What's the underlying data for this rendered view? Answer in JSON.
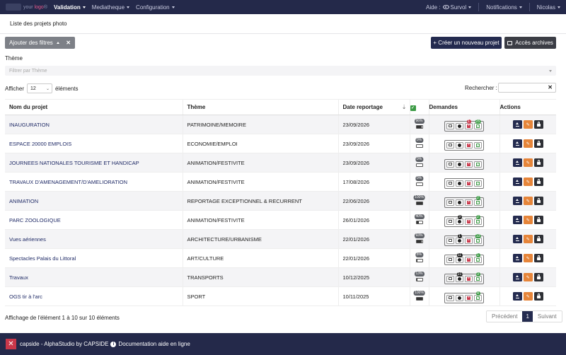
{
  "nav": {
    "logo_prefix": "your",
    "logo_accent": "logo",
    "logo_suffix": "®",
    "items": [
      {
        "label": "Validation",
        "active": true
      },
      {
        "label": "Mediatheque"
      },
      {
        "label": "Configuration"
      }
    ],
    "right": {
      "aide": "Aide :",
      "survol": "Survol",
      "notifications": "Notifications",
      "user": "Nicolas"
    }
  },
  "page": {
    "title": "Liste des projets photo"
  },
  "toolbar": {
    "filters_label": "Ajouter des filtres",
    "new_project": "+ Créer un nouveau projet",
    "archives": "Accès archives"
  },
  "theme_filter": {
    "label": "Thème",
    "placeholder": "Filtrer par Thème"
  },
  "length": {
    "prefix": "Afficher",
    "value": "12",
    "suffix": "éléments"
  },
  "search": {
    "label": "Rechercher :",
    "value": ""
  },
  "table": {
    "headers": {
      "name": "Nom du projet",
      "theme": "Thème",
      "date": "Date reportage",
      "requests": "Demandes",
      "actions": "Actions"
    },
    "rows": [
      {
        "name": "INAUGURATION",
        "theme": "PATRIMOINE/MEMOIRE",
        "date": "23/09/2026",
        "pct": "96%",
        "fill": 0.96,
        "clk": "",
        "x": "1",
        "ok": "25"
      },
      {
        "name": "ESPACE 20000 EMPLOIS",
        "theme": "ECONOMIE/EMPLOI",
        "date": "23/09/2026",
        "pct": "0%",
        "fill": 0,
        "clk": "",
        "x": "",
        "ok": ""
      },
      {
        "name": "JOURNEES NATIONALES TOURISME ET HANDICAP",
        "theme": "ANIMATION/FESTIVITE",
        "date": "23/09/2026",
        "pct": "0%",
        "fill": 0,
        "clk": "",
        "x": "",
        "ok": ""
      },
      {
        "name": "TRAVAUX D'AMENAGEMENT/D'AMELIORATION",
        "theme": "ANIMATION/FESTIVITE",
        "date": "17/08/2026",
        "pct": "0%",
        "fill": 0,
        "clk": "",
        "x": "",
        "ok": ""
      },
      {
        "name": "ANIMATION",
        "theme": "REPORTAGE EXCEPTIONNEL & RECURRENT",
        "date": "22/06/2026",
        "pct": "100%",
        "fill": 1,
        "clk": "",
        "x": "",
        "ok": "2"
      },
      {
        "name": "PARC ZOOLOGIQUE",
        "theme": "ANIMATION/FESTIVITE",
        "date": "26/01/2026",
        "pct": "40%",
        "fill": 0.4,
        "clk": "3",
        "x": "",
        "ok": "2"
      },
      {
        "name": "Vues aériennes",
        "theme": "ARCHITECTURE/URBANISME",
        "date": "22/01/2026",
        "pct": "93%",
        "fill": 0.93,
        "clk": "1",
        "x": "",
        "ok": "13"
      },
      {
        "name": "Spectacles Palais du Littoral",
        "theme": "ART/CULTURE",
        "date": "22/01/2026",
        "pct": "8%",
        "fill": 0.08,
        "clk": "11",
        "x": "",
        "ok": "1"
      },
      {
        "name": "Travaux",
        "theme": "TRANSPORTS",
        "date": "10/12/2025",
        "pct": "13%",
        "fill": 0.13,
        "clk": "21",
        "x": "",
        "ok": "3"
      },
      {
        "name": "OGS tir à l'arc",
        "theme": "SPORT",
        "date": "10/11/2025",
        "pct": "100%",
        "fill": 1,
        "clk": "",
        "x": "",
        "ok": "4"
      }
    ]
  },
  "info": "Affichage de l'élément 1 à 10 sur 10 éléments",
  "pager": {
    "prev": "Précédent",
    "page": "1",
    "next": "Suivant"
  },
  "footer": {
    "brand": "capside",
    "credit": "- AlphaStudio by CAPSIDE",
    "doc": "Documentation aide en ligne"
  },
  "colors": {
    "navy": "#24294a",
    "accent": "#242b4f",
    "red": "#c9374a",
    "green": "#3b9a44",
    "orange": "#e6853a"
  }
}
